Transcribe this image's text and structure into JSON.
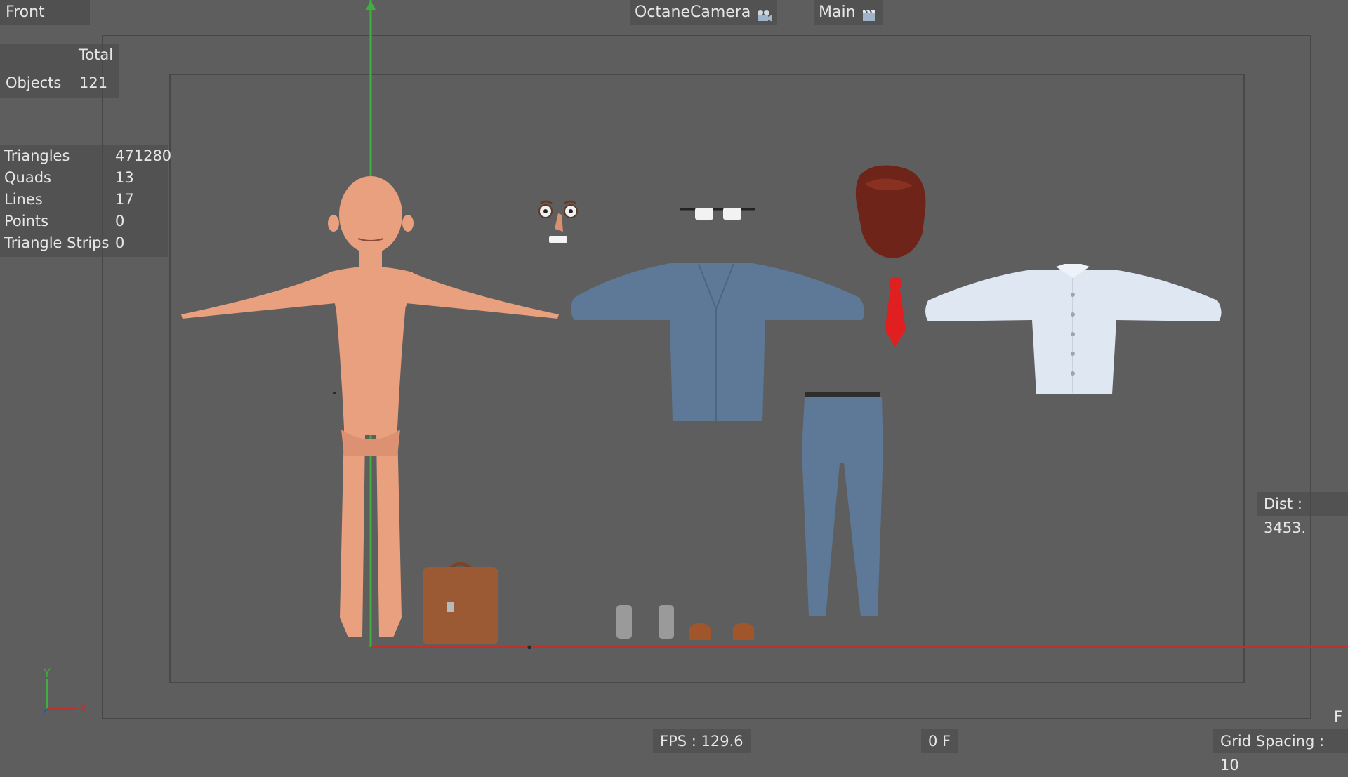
{
  "viewport": {
    "view_name": "Front",
    "camera_label": "OctaneCamera",
    "display_label": "Main",
    "icons": {
      "camera": "camera-icon",
      "display": "clapper-icon"
    }
  },
  "stats_total": {
    "header": "Total",
    "objects_label": "Objects",
    "objects_value": "121"
  },
  "stats_detail": [
    {
      "label": "Triangles",
      "value": "471280"
    },
    {
      "label": "Quads",
      "value": "13"
    },
    {
      "label": "Lines",
      "value": "17"
    },
    {
      "label": "Points",
      "value": "0"
    },
    {
      "label": "Triangle Strips",
      "value": "0"
    }
  ],
  "hud": {
    "fps": "FPS : 129.6",
    "frame": "0 F",
    "grid_spacing": "Grid Spacing : 10",
    "dist": "Dist : 3453.",
    "corner": "F"
  },
  "axes": {
    "y_label": "Y",
    "x_label": "X"
  },
  "colors": {
    "background": "#5e5e5e",
    "y_axis": "#3fb03f",
    "x_axis": "#c0302c",
    "skin": "#e9a07e",
    "suit": "#5e7897",
    "shirt": "#dfe7f2",
    "tie": "#e02020",
    "hair": "#6e2418",
    "leather": "#9b5a33"
  }
}
